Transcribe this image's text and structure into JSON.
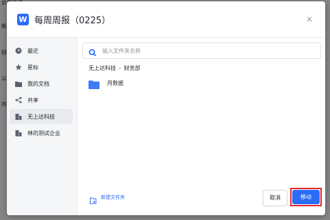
{
  "modal": {
    "app_logo": "W",
    "title": "每周周报（0225）",
    "close": "×"
  },
  "sidebar": {
    "items": [
      {
        "label": "最近",
        "icon": "clock-icon"
      },
      {
        "label": "星标",
        "icon": "star-icon"
      },
      {
        "label": "我的文档",
        "icon": "folder-icon"
      },
      {
        "label": "共享",
        "icon": "share-icon"
      },
      {
        "label": "无上达科技",
        "icon": "company-icon",
        "active": true
      },
      {
        "label": "林的测试企业",
        "icon": "company-icon"
      }
    ]
  },
  "search": {
    "placeholder": "输入文件夹名称",
    "value": ""
  },
  "breadcrumb": [
    "无上达科技",
    "财务部"
  ],
  "folders": [
    {
      "name": "月数据"
    }
  ],
  "footer": {
    "new_folder_label": "新建文件夹",
    "cancel_label": "取消",
    "move_label": "移动"
  },
  "colors": {
    "accent": "#2b6cf6",
    "highlight": "#e32626"
  }
}
